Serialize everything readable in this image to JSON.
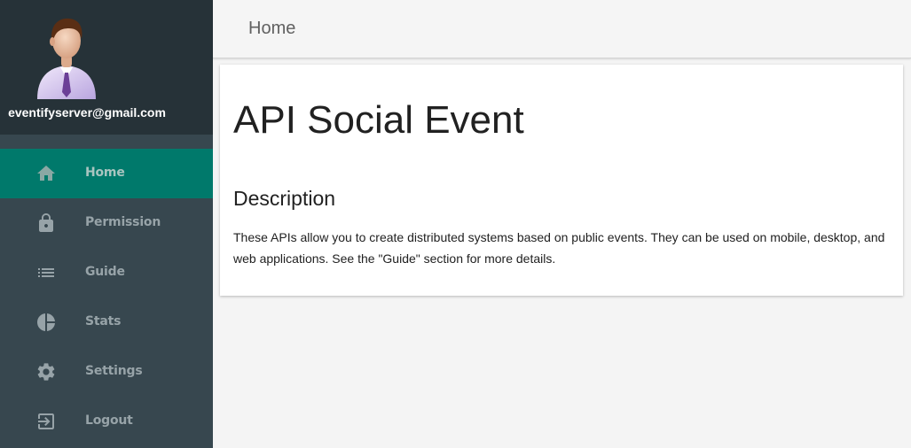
{
  "user": {
    "email": "eventifyserver@gmail.com"
  },
  "header": {
    "title": "Home"
  },
  "nav": {
    "items": [
      {
        "label": "Home",
        "icon": "home-icon",
        "active": true
      },
      {
        "label": "Permission",
        "icon": "lock-icon"
      },
      {
        "label": "Guide",
        "icon": "list-icon"
      },
      {
        "label": "Stats",
        "icon": "pie-chart-icon"
      },
      {
        "label": "Settings",
        "icon": "gear-icon"
      },
      {
        "label": "Logout",
        "icon": "logout-icon"
      }
    ]
  },
  "main": {
    "title": "API Social Event",
    "section_heading": "Description",
    "description": "These APIs allow you to create distributed systems based on public events. They can be used on mobile, desktop, and web applications. See the \"Guide\" section for more details."
  },
  "colors": {
    "sidebar": "#37474f",
    "profile_bg": "#263238",
    "active_item": "#00796b",
    "page_bg": "#f4f4f4"
  }
}
